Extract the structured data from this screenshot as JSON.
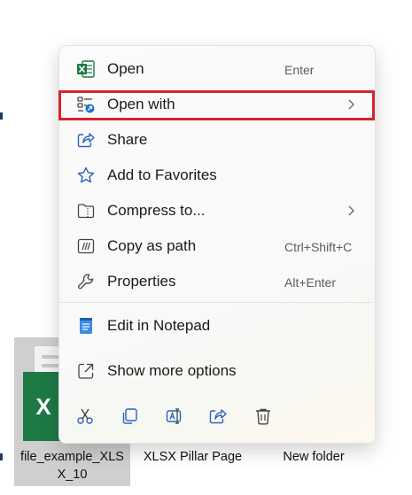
{
  "menu": {
    "items": [
      {
        "label": "Open",
        "shortcut": "Enter",
        "icon": "excel-icon"
      },
      {
        "label": "Open with",
        "shortcut": "",
        "icon": "open-with-icon",
        "has_submenu": true,
        "highlighted": true
      },
      {
        "label": "Share",
        "shortcut": "",
        "icon": "share-icon"
      },
      {
        "label": "Add to Favorites",
        "shortcut": "",
        "icon": "star-icon"
      },
      {
        "label": "Compress to...",
        "shortcut": "",
        "icon": "zip-folder-icon",
        "has_submenu": true
      },
      {
        "label": "Copy as path",
        "shortcut": "Ctrl+Shift+C",
        "icon": "copy-path-icon"
      },
      {
        "label": "Properties",
        "shortcut": "Alt+Enter",
        "icon": "wrench-icon"
      },
      {
        "label": "Edit in Notepad",
        "shortcut": "",
        "icon": "notepad-icon"
      },
      {
        "label": "Show more options",
        "shortcut": "",
        "icon": "show-more-icon"
      }
    ],
    "quick_actions": [
      "cut-icon",
      "copy-icon",
      "rename-icon",
      "share-icon",
      "delete-icon"
    ],
    "highlight_color": "#d8232a"
  },
  "desktop": {
    "files": [
      {
        "label_line1": "file_example_XLS",
        "label_line2": "X_10",
        "icon": "excel-file-icon",
        "selected": true
      },
      {
        "label_line1": "XLSX Pillar Page",
        "label_line2": "",
        "icon": "",
        "selected": false
      },
      {
        "label_line1": "New folder",
        "label_line2": "",
        "icon": "",
        "selected": false
      }
    ],
    "excel_badge": "X"
  }
}
